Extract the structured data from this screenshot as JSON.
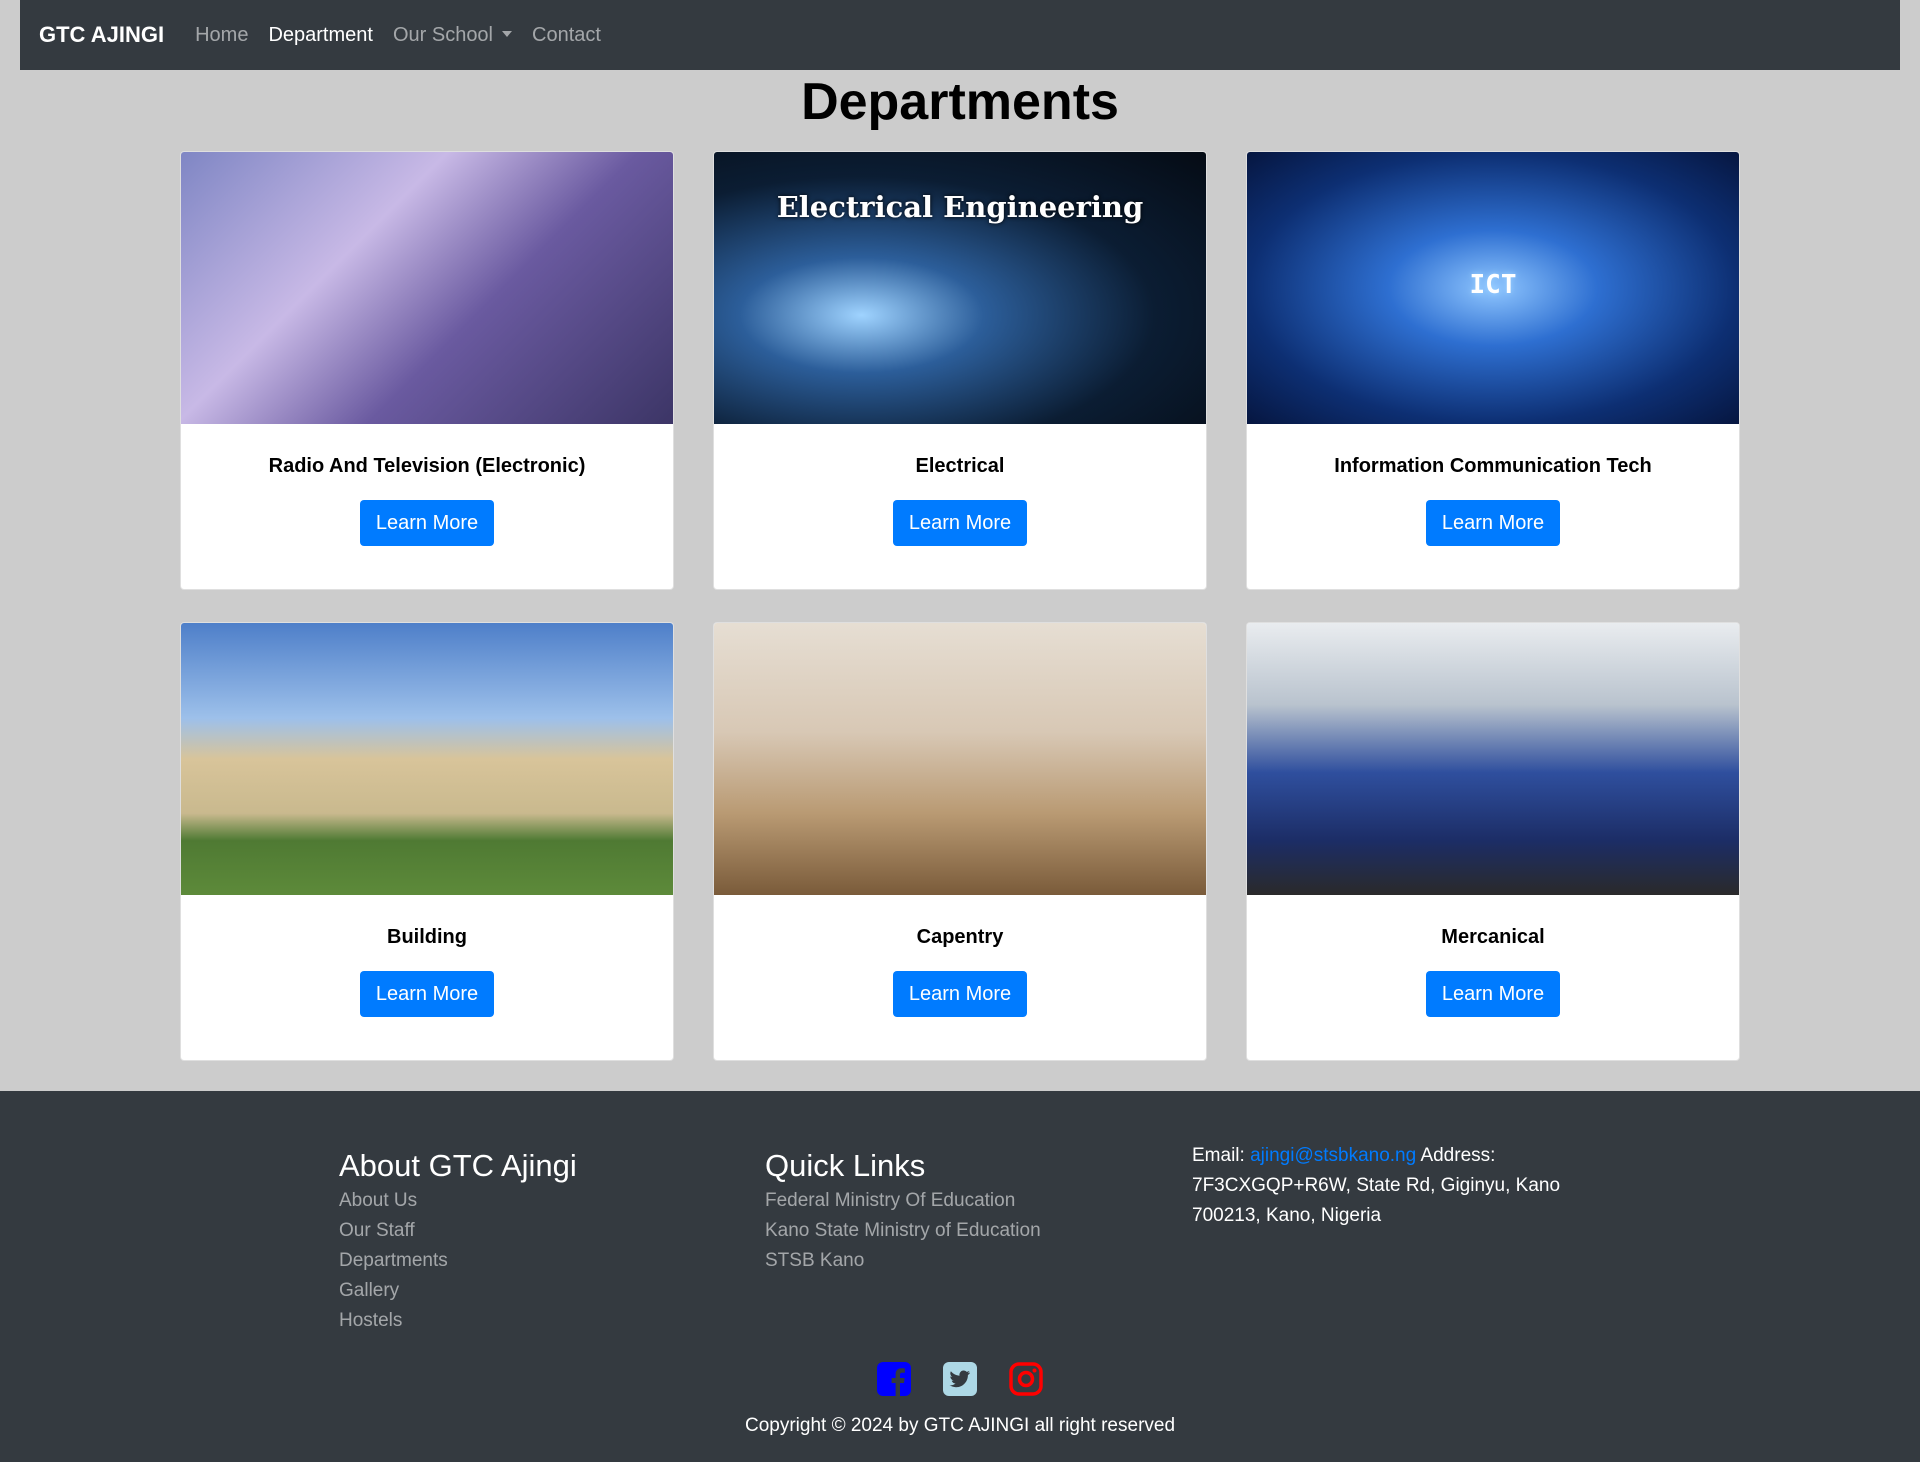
{
  "navbar": {
    "brand": "GTC AJINGI",
    "links": [
      "Home",
      "Department",
      "Our School",
      "Contact"
    ]
  },
  "page": {
    "title": "Departments"
  },
  "departments": [
    {
      "title": "Radio And Television (Electronic)",
      "button": "Learn More"
    },
    {
      "title": "Electrical",
      "button": "Learn More",
      "image_text": "Electrical Engineering"
    },
    {
      "title": "Information Communication Tech",
      "button": "Learn More",
      "image_text": "ICT"
    },
    {
      "title": "Building",
      "button": "Learn More"
    },
    {
      "title": "Capentry",
      "button": "Learn More"
    },
    {
      "title": "Mercanical",
      "button": "Learn More"
    }
  ],
  "footer": {
    "about": {
      "heading": "About GTC Ajingi",
      "links": [
        "About Us",
        "Our Staff",
        "Departments",
        "Gallery",
        "Hostels"
      ]
    },
    "quick_links": {
      "heading": "Quick Links",
      "links": [
        "Federal Ministry Of Education",
        "Kano State Ministry of Education",
        "STSB Kano"
      ]
    },
    "contact": {
      "email_label": "Email:",
      "email": "ajingi@stsbkano.ng",
      "address": "Address: 7F3CXGQP+R6W, State Rd, Giginyu, Kano 700213, Kano, Nigeria"
    },
    "social_icons": [
      "facebook-icon",
      "twitter-icon",
      "instagram-icon"
    ],
    "copyright": "Copyright © 2024 by GTC AJINGI all right reserved"
  },
  "colors": {
    "navbar_bg": "#343a40",
    "page_bg": "#cccccc",
    "button_primary": "#007bff",
    "facebook": "#0000ff",
    "twitter": "#add8e6",
    "instagram": "#ff0000"
  }
}
